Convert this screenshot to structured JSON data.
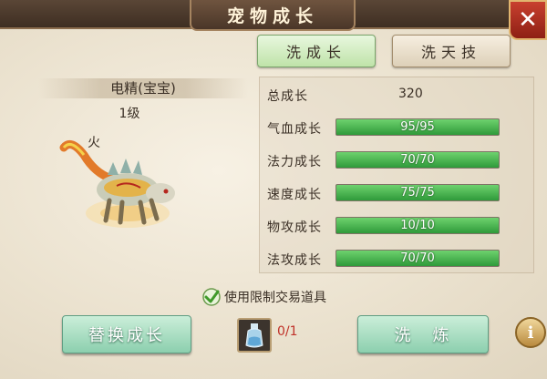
{
  "window": {
    "title": "宠物成长",
    "close_label": "✕"
  },
  "tabs": [
    {
      "label": "洗成长",
      "active": true
    },
    {
      "label": "洗天技",
      "active": false
    }
  ],
  "pet": {
    "name": "电精(宝宝)",
    "level": "1级",
    "element": "火"
  },
  "stats": {
    "total": {
      "label": "总成长",
      "value": "320"
    },
    "bars": [
      {
        "label": "气血成长",
        "value": "95/95",
        "fill": 1.0
      },
      {
        "label": "法力成长",
        "value": "70/70",
        "fill": 1.0
      },
      {
        "label": "速度成长",
        "value": "75/75",
        "fill": 1.0
      },
      {
        "label": "物攻成长",
        "value": "10/10",
        "fill": 1.0
      },
      {
        "label": "法攻成长",
        "value": "70/70",
        "fill": 1.0
      }
    ]
  },
  "options": {
    "use_restricted_items_label": "使用限制交易道具",
    "checked": true
  },
  "actions": {
    "replace_label": "替换成长",
    "wash_label": "洗　炼",
    "item_count": "0/1",
    "info_label": "i"
  },
  "colors": {
    "bar_green": "#2f9a3a",
    "count_red": "#c0322a",
    "close_red": "#c8402f"
  }
}
